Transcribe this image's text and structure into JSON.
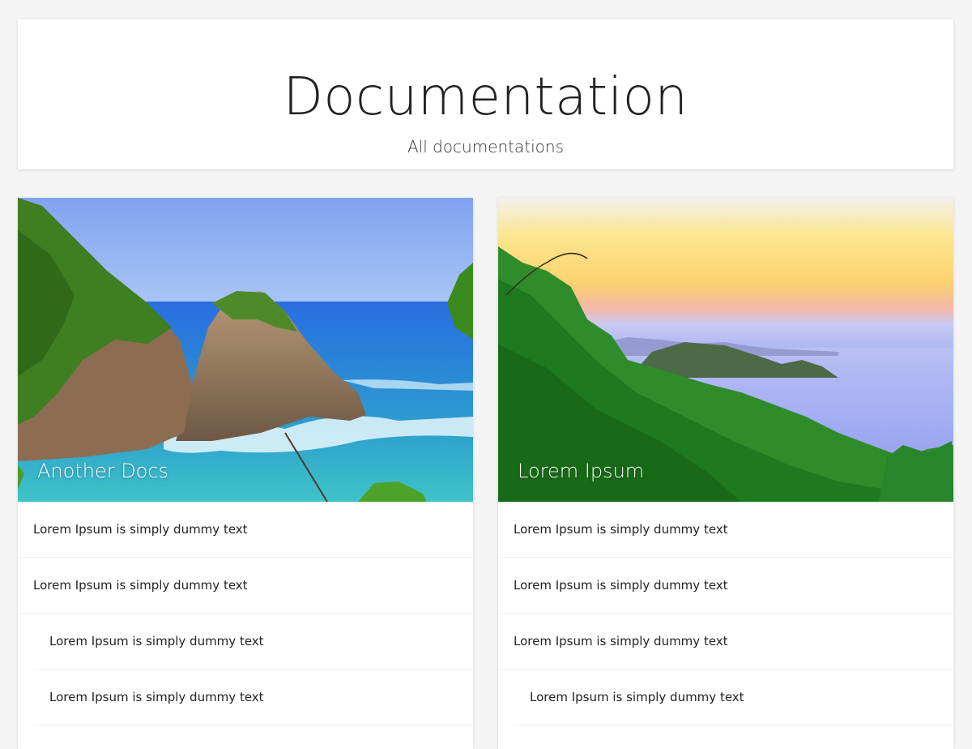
{
  "header": {
    "title": "Documentation",
    "subtitle": "All documentations"
  },
  "cards": [
    {
      "title": "Another Docs",
      "image": "coastal-rocks-ocean",
      "items": [
        {
          "label": "Lorem Ipsum is simply dummy text",
          "level": 0
        },
        {
          "label": "Lorem Ipsum is simply dummy text",
          "level": 0
        },
        {
          "label": "Lorem Ipsum is simply dummy text",
          "level": 1
        },
        {
          "label": "Lorem Ipsum is simply dummy text",
          "level": 1
        }
      ]
    },
    {
      "title": "Lorem Ipsum",
      "image": "sunset-forest-bay",
      "items": [
        {
          "label": "Lorem Ipsum is simply dummy text",
          "level": 0
        },
        {
          "label": "Lorem Ipsum is simply dummy text",
          "level": 0
        },
        {
          "label": "Lorem Ipsum is simply dummy text",
          "level": 0
        },
        {
          "label": "Lorem Ipsum is simply dummy text",
          "level": 1
        }
      ]
    }
  ],
  "colors": {
    "background": "#f4f4f4",
    "card": "#ffffff",
    "text": "#222222"
  }
}
